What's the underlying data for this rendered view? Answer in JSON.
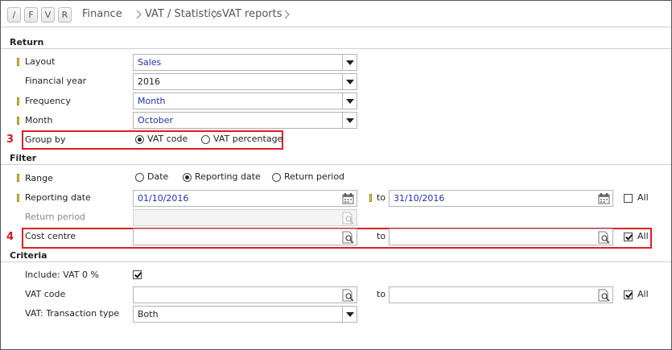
{
  "toolbar": {
    "keys": [
      "/",
      "F",
      "V",
      "R"
    ],
    "breadcrumb": [
      "Finance",
      "VAT / Statistics",
      "VAT reports"
    ]
  },
  "return_section": {
    "title": "Return",
    "layout": {
      "label": "Layout",
      "value": "Sales"
    },
    "financial_year": {
      "label": "Financial year",
      "value": "2016"
    },
    "frequency": {
      "label": "Frequency",
      "value": "Month"
    },
    "month": {
      "label": "Month",
      "value": "October"
    },
    "group_by": {
      "label": "Group by",
      "options": [
        "VAT code",
        "VAT percentage"
      ],
      "selected": "VAT code"
    }
  },
  "filter_section": {
    "title": "Filter",
    "range": {
      "label": "Range",
      "options": [
        "Date",
        "Reporting date",
        "Return period"
      ],
      "selected": "Reporting date"
    },
    "reporting_date": {
      "label": "Reporting date",
      "from": "01/10/2016",
      "to_label": "to",
      "to": "31/10/2016",
      "all_label": "All",
      "all_checked": false
    },
    "return_period": {
      "label": "Return period",
      "value": ""
    },
    "cost_centre": {
      "label": "Cost centre",
      "from": "",
      "to_label": "to",
      "to": "",
      "all_label": "All",
      "all_checked": true
    }
  },
  "criteria_section": {
    "title": "Criteria",
    "include_vat0": {
      "label": "Include: VAT 0 %",
      "checked": true
    },
    "vat_code": {
      "label": "VAT code",
      "from": "",
      "to_label": "to",
      "to": "",
      "all_label": "All",
      "all_checked": true
    },
    "transaction_type": {
      "label": "VAT: Transaction type",
      "value": "Both"
    }
  },
  "annotations": {
    "group_by_marker": "3",
    "cost_centre_marker": "4"
  },
  "colors": {
    "required_marker": "#f0d440",
    "annotation_red": "#e01b2a",
    "value_blue": "#2230b8"
  }
}
